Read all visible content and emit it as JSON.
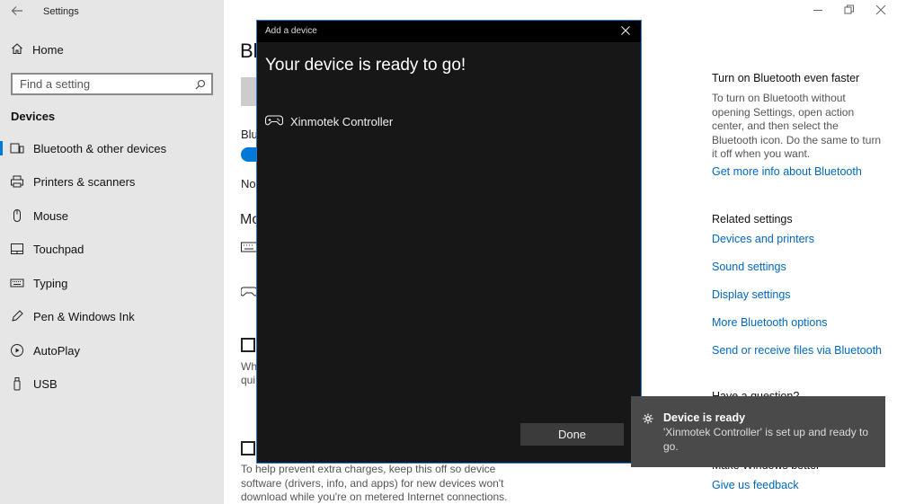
{
  "window": {
    "app_title": "Settings"
  },
  "sidebar": {
    "home_label": "Home",
    "search_placeholder": "Find a setting",
    "section_heading": "Devices",
    "items": [
      {
        "label": "Bluetooth & other devices",
        "icon": "bluetooth-devices-icon",
        "active": true
      },
      {
        "label": "Printers & scanners",
        "icon": "printer-icon"
      },
      {
        "label": "Mouse",
        "icon": "mouse-icon"
      },
      {
        "label": "Touchpad",
        "icon": "touchpad-icon"
      },
      {
        "label": "Typing",
        "icon": "keyboard-icon"
      },
      {
        "label": "Pen & Windows Ink",
        "icon": "pen-icon"
      },
      {
        "label": "AutoPlay",
        "icon": "autoplay-icon"
      },
      {
        "label": "USB",
        "icon": "usb-icon"
      }
    ]
  },
  "main": {
    "title_fragment": "Bl",
    "bluetooth_label_fragment": "Blu",
    "now_fragment": "No",
    "mouse_fragment": "Mo",
    "when_fragment_1": "Wh",
    "when_fragment_2": "qui",
    "metered_note": "To help prevent extra charges, keep this off so device software (drivers, info, and apps) for new devices won't download while you're on metered Internet connections."
  },
  "right_panel": {
    "faster_heading": "Turn on Bluetooth even faster",
    "faster_body": "To turn on Bluetooth without opening Settings, open action center, and then select the Bluetooth icon. Do the same to turn it off when you want.",
    "more_info_link": "Get more info about Bluetooth",
    "related_heading": "Related settings",
    "related_links": [
      "Devices and printers",
      "Sound settings",
      "Display settings",
      "More Bluetooth options",
      "Send or receive files via Bluetooth"
    ],
    "question_fragment": "Have a question?",
    "better_fragment": "Make Windows better",
    "feedback_link": "Give us feedback"
  },
  "dialog": {
    "title": "Add a device",
    "heading": "Your device is ready to go!",
    "device_name": "Xinmotek Controller",
    "device_icon": "gamepad-icon",
    "done_label": "Done"
  },
  "toast": {
    "icon": "gear-icon",
    "title": "Device is ready",
    "body": "'Xinmotek Controller' is set up and ready to go."
  },
  "colors": {
    "accent": "#0078d7",
    "link": "#0067c0",
    "dialog_bg": "#171717",
    "toast_bg": "#4a4a4a"
  }
}
